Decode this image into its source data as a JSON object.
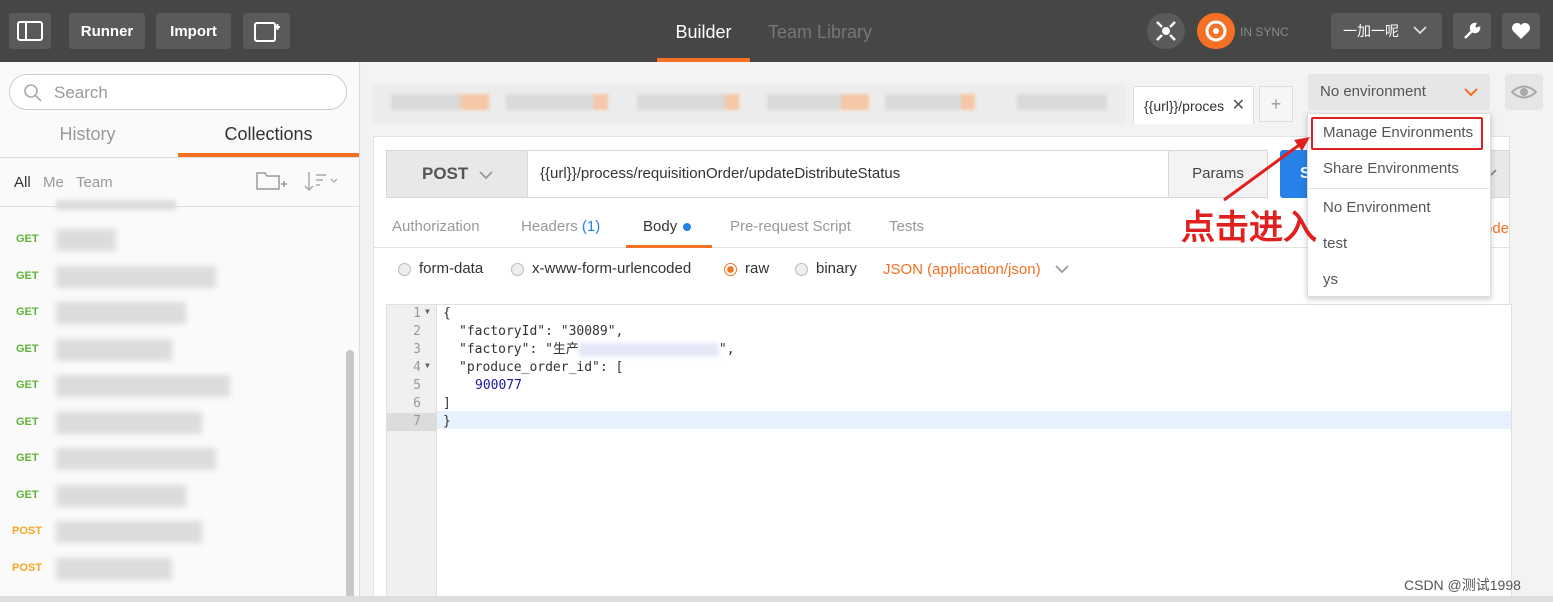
{
  "topbar": {
    "runner": "Runner",
    "import": "Import",
    "tabs": [
      "Builder",
      "Team Library"
    ],
    "sync_status": "IN SYNC",
    "user": "一加一呢"
  },
  "sidebar": {
    "search_placeholder": "Search",
    "tabs": [
      "History",
      "Collections"
    ],
    "filters": [
      "All",
      "Me",
      "Team"
    ],
    "requests": [
      {
        "method": "GET"
      },
      {
        "method": "GET"
      },
      {
        "method": "GET"
      },
      {
        "method": "GET"
      },
      {
        "method": "GET"
      },
      {
        "method": "GET"
      },
      {
        "method": "GET"
      },
      {
        "method": "GET"
      },
      {
        "method": "POST"
      },
      {
        "method": "POST"
      }
    ],
    "method_colors": {
      "GET": "#5fb435",
      "POST": "#f5a623"
    }
  },
  "main": {
    "open_tab": "{{url}}/proces",
    "environment": "No environment",
    "method": "POST",
    "url": "{{url}}/process/requisitionOrder/updateDistributeStatus",
    "params": "Params",
    "send": "S",
    "subtabs": {
      "authorization": "Authorization",
      "headers": "Headers",
      "headers_count": "(1)",
      "body": "Body",
      "prerequest": "Pre-request Script",
      "tests": "Tests",
      "code": "ode"
    },
    "body_modes": [
      "form-data",
      "x-www-form-urlencoded",
      "raw",
      "binary"
    ],
    "selected_mode": "raw",
    "content_type": "JSON (application/json)",
    "code_lines": [
      "{",
      "\"factoryId\": \"30089\",",
      "\"factory\": \"生产",
      "\"produce_order_id\": [",
      "900077",
      "]",
      "}"
    ]
  },
  "env_menu": [
    "Manage Environments",
    "Share Environments",
    "No Environment",
    "test",
    "ys"
  ],
  "annotation": "点击进入",
  "watermark": "CSDN @测试1998"
}
